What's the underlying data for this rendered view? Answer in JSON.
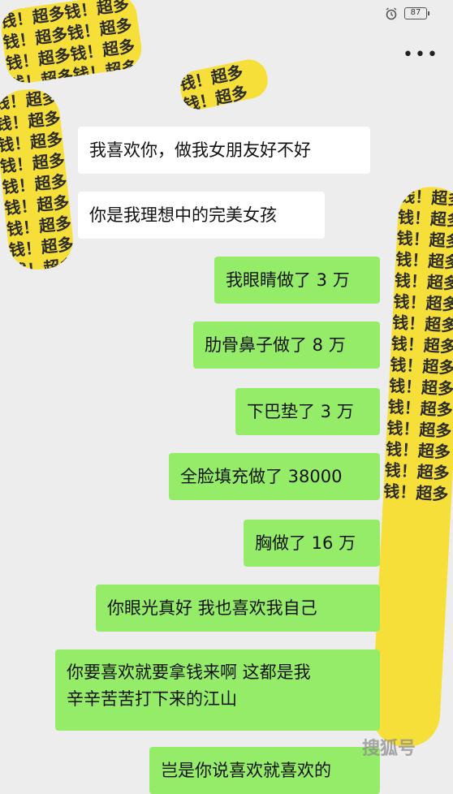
{
  "status_bar": {
    "battery_level": "87"
  },
  "toolbar": {
    "more_label": "•••"
  },
  "sticker_text": "钱！超多钱！超多钱！超多钱！超多钱！超多钱！超多钱！超多钱！超多钱！超多钱！超多钱！超多钱！超多钱！超多钱！超多钱！超多",
  "messages": [
    {
      "side": "incoming",
      "text": "我喜欢你，做我女朋友好不好"
    },
    {
      "side": "incoming",
      "text": "你是我理想中的完美女孩"
    },
    {
      "side": "outgoing",
      "text": "我眼睛做了 3 万"
    },
    {
      "side": "outgoing",
      "text": "肋骨鼻子做了 8 万"
    },
    {
      "side": "outgoing",
      "text": "下巴垫了 3 万"
    },
    {
      "side": "outgoing",
      "text": "全脸填充做了 38000"
    },
    {
      "side": "outgoing",
      "text": "胸做了 16 万"
    },
    {
      "side": "outgoing",
      "text": "你眼光真好  我也喜欢我自己"
    },
    {
      "side": "outgoing",
      "line1": "你要喜欢就要拿钱来啊  这都是我",
      "line2": "辛辛苦苦打下来的江山"
    },
    {
      "side": "outgoing",
      "text": "岂是你说喜欢就喜欢的"
    }
  ],
  "watermark": "搜狐号"
}
